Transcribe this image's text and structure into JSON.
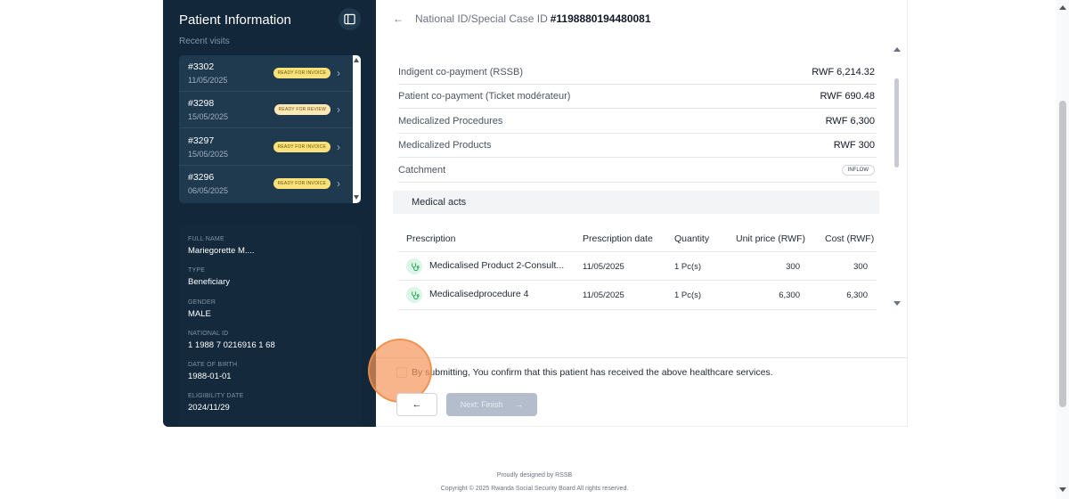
{
  "sidebar": {
    "title": "Patient Information",
    "recent_label": "Recent visits",
    "visits": [
      {
        "id": "#3302",
        "date": "11/05/2025",
        "status": "READY FOR INVOICE"
      },
      {
        "id": "#3298",
        "date": "15/05/2025",
        "status": "READY FOR REVIEW"
      },
      {
        "id": "#3297",
        "date": "15/05/2025",
        "status": "READY FOR INVOICE"
      },
      {
        "id": "#3296",
        "date": "06/05/2025",
        "status": "READY FOR INVOICE"
      }
    ],
    "fields": [
      {
        "label": "FULL NAME",
        "value": "Mariegorette M...."
      },
      {
        "label": "TYPE",
        "value": "Beneficiary"
      },
      {
        "label": "GENDER",
        "value": "MALE"
      },
      {
        "label": "NATIONAL ID",
        "value": "1 1988 7 0216916 1 68"
      },
      {
        "label": "DATE OF BIRTH",
        "value": "1988-01-01"
      },
      {
        "label": "ELIGIBILITY DATE",
        "value": "2024/11/29"
      }
    ]
  },
  "header": {
    "label": "National ID/Special Case ID",
    "id": "#1198880194480081"
  },
  "payments": [
    {
      "label": "Indigent co-payment (RSSB)",
      "value": "RWF 6,214.32"
    },
    {
      "label": "Patient co-payment (Ticket modérateur)",
      "value": "RWF 690.48"
    },
    {
      "label": "Medicalized Procedures",
      "value": "RWF 6,300"
    },
    {
      "label": "Medicalized Products",
      "value": "RWF 300"
    },
    {
      "label": "Catchment",
      "value": "INFLOW"
    }
  ],
  "acts": {
    "title": "Medical acts",
    "headers": [
      "Prescription",
      "Prescription date",
      "Quantity",
      "Unit price (RWF)",
      "Cost (RWF)"
    ],
    "rows": [
      {
        "name": "Medicalised Product 2-Consult...",
        "date": "11/05/2025",
        "qty": "1 Pc(s)",
        "unit": "300",
        "cost": "300"
      },
      {
        "name": "Medicalisedprocedure 4",
        "date": "11/05/2025",
        "qty": "1 Pc(s)",
        "unit": "6,300",
        "cost": "6,300"
      }
    ]
  },
  "confirm_text": "By submitting, You confirm that this patient has received the above healthcare services.",
  "buttons": {
    "back": "←",
    "next": "Next: Finish",
    "next_arrow": "→"
  },
  "footer": {
    "line1": "Proudly designed by RSSB",
    "line2": "Copyright © 2025 Rwanda Social Security Board All rights reserved."
  },
  "colors": {
    "sidebar_bg": "#12283a",
    "badge_invoice": "#f9e27c",
    "badge_review": "#fde9b8",
    "next_disabled": "#b3bdcc",
    "highlight": "#f5965a"
  },
  "icons": [
    "sidebar-toggle-icon",
    "back-arrow-icon",
    "chevron-right-icon",
    "stethoscope-icon",
    "arrow-right-icon"
  ]
}
